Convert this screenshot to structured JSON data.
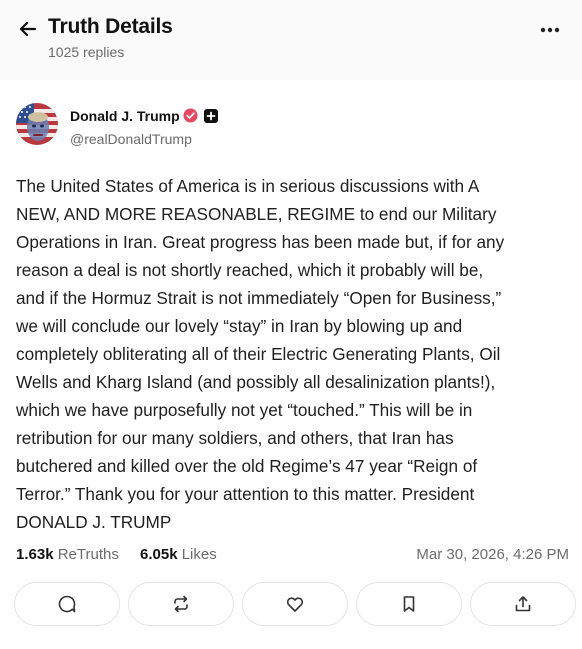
{
  "header": {
    "title": "Truth Details",
    "replies": "1025 replies"
  },
  "author": {
    "name": "Donald J. Trump",
    "handle": "@realDonaldTrump"
  },
  "post": {
    "lines": [
      "The United States of America is in serious discussions with A",
      "NEW, AND MORE REASONABLE, REGIME to end our Military",
      "Operations in Iran. Great progress has been made but, if for any",
      "reason a deal is not shortly reached, which it probably will be,",
      "and if the Hormuz Strait is not immediately “Open for Business,”",
      "we will conclude our lovely “stay” in Iran by blowing up and",
      "completely obliterating all of their Electric Generating Plants, Oil",
      "Wells and Kharg Island (and possibly all desalinization plants!),",
      "which we have purposefully not yet “touched.” This will be in",
      "retribution for our many soldiers, and others, that Iran has",
      "butchered and killed over the old Regime’s 47 year “Reign of",
      "Terror.” Thank you for your attention to this matter. President",
      "DONALD J. TRUMP"
    ]
  },
  "stats": {
    "retruths_count": "1.63k",
    "retruths_label": "ReTruths",
    "likes_count": "6.05k",
    "likes_label": "Likes",
    "timestamp": "Mar 30, 2026, 4:26 PM"
  },
  "actions": {
    "icons": [
      "reply-icon",
      "retruth-icon",
      "like-icon",
      "bookmark-icon",
      "share-icon"
    ]
  },
  "colors": {
    "verified_badge": "#e24a63",
    "text_primary": "#1f1f1f",
    "text_secondary": "#6b6b6b",
    "border": "#e3e3e3",
    "header_bg": "#fafafa"
  }
}
